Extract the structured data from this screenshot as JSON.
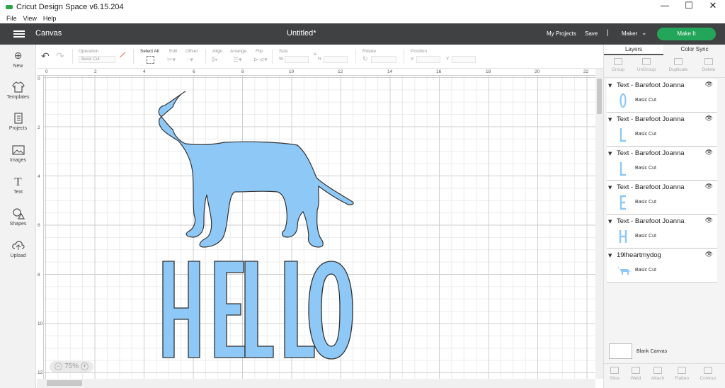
{
  "window": {
    "title": "Cricut Design Space  v6.15.204",
    "min": "—",
    "max": "☐",
    "close": "✕"
  },
  "menu": [
    "File",
    "View",
    "Help"
  ],
  "topnav": {
    "section": "Canvas",
    "doc_title": "Untitled*",
    "my_projects": "My Projects",
    "save": "Save",
    "separator": "|",
    "machine": "Maker",
    "make_it": "Make It",
    "accent": "#23a55a"
  },
  "sidebar": {
    "items": [
      {
        "label": "New",
        "icon": "plus-circle-icon"
      },
      {
        "label": "Templates",
        "icon": "shirt-icon"
      },
      {
        "label": "Projects",
        "icon": "projects-icon"
      },
      {
        "label": "Images",
        "icon": "image-icon"
      },
      {
        "label": "Text",
        "icon": "text-icon"
      },
      {
        "label": "Shapes",
        "icon": "shapes-icon"
      },
      {
        "label": "Upload",
        "icon": "upload-icon"
      }
    ]
  },
  "toolbar": {
    "operation_label": "Operation",
    "operation_value": "Basic Cut",
    "select_all": "Select All",
    "edit": "Edit",
    "offset": "Offset",
    "align": "Align",
    "arrange": "Arrange",
    "flip": "Flip",
    "size": "Size",
    "w": "W",
    "h": "H",
    "rotate": "Rotate",
    "position": "Position",
    "x": "X",
    "y": "Y"
  },
  "rulers": {
    "top": [
      "0",
      "2",
      "4",
      "6",
      "8",
      "10",
      "12",
      "14",
      "16",
      "18",
      "20",
      "22"
    ],
    "left": [
      "0",
      "2",
      "4",
      "6",
      "8",
      "10",
      "12"
    ]
  },
  "canvas": {
    "zoom": "75%",
    "zoom_minus": "−",
    "zoom_plus": "+",
    "fill_color": "#8ec8f6",
    "stroke_color": "#333333"
  },
  "panel": {
    "tabs": [
      "Layers",
      "Color Sync"
    ],
    "tools": [
      "Group",
      "UnGroup",
      "Duplicate",
      "Delete"
    ],
    "layers": [
      {
        "name": "Text - Barefoot Joanna",
        "op": "Basic Cut",
        "glyph": "O"
      },
      {
        "name": "Text - Barefoot Joanna",
        "op": "Basic Cut",
        "glyph": "L"
      },
      {
        "name": "Text - Barefoot Joanna",
        "op": "Basic Cut",
        "glyph": "L"
      },
      {
        "name": "Text - Barefoot Joanna",
        "op": "Basic Cut",
        "glyph": "E"
      },
      {
        "name": "Text - Barefoot Joanna",
        "op": "Basic Cut",
        "glyph": "H"
      },
      {
        "name": "19lheartmydog",
        "op": "Basic Cut",
        "glyph": "dog"
      }
    ],
    "blank_canvas": "Blank Canvas",
    "bottom_tools": [
      "Slice",
      "Weld",
      "Attach",
      "Flatten",
      "Contour"
    ]
  }
}
